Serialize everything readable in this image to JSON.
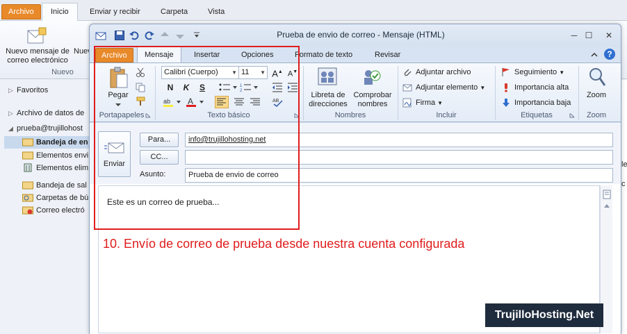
{
  "bg_window": {
    "tabs": [
      "Archivo",
      "Inicio",
      "Enviar y recibir",
      "Carpeta",
      "Vista"
    ],
    "new_mail_label": "Nuevo mensaje de correo electrónico",
    "new_item_label": "Nuevos elem",
    "group_label": "Nuevo",
    "nav": {
      "favorites": "Favoritos",
      "data_file": "Archivo de datos de",
      "account": "prueba@trujillohost",
      "folders": [
        {
          "label": "Bandeja de en",
          "icon": "inbox-icon"
        },
        {
          "label": "Elementos envi",
          "icon": "sent-items-icon"
        },
        {
          "label": "Elementos elim",
          "icon": "deleted-items-icon"
        },
        {
          "label": "Bandeja de sal",
          "icon": "outbox-icon"
        },
        {
          "label": "Carpetas de bú",
          "icon": "search-folder-icon"
        },
        {
          "label": "Correo electró",
          "icon": "junk-mail-icon"
        }
      ]
    },
    "right_fragments": [
      "le",
      "c"
    ]
  },
  "message_window": {
    "title": "Prueba de envio de correo  -  Mensaje (HTML)",
    "window_controls": {
      "minimize": "─",
      "maximize": "☐",
      "close": "✕"
    },
    "tabs": {
      "archivo": "Archivo",
      "mensaje": "Mensaje",
      "insertar": "Insertar",
      "opciones": "Opciones",
      "formato": "Formato de texto",
      "revisar": "Revisar"
    },
    "ribbon": {
      "paste": "Pegar",
      "group_clipboard": "Portapapeles",
      "font_name": "Calibri (Cuerpo)",
      "font_size": "11",
      "bold": "N",
      "italic": "K",
      "underline": "S",
      "group_basic_text": "Texto básico",
      "address_book": "Libreta de direcciones",
      "check_names": "Comprobar nombres",
      "group_names": "Nombres",
      "attach_file": "Adjuntar archivo",
      "attach_item": "Adjuntar elemento",
      "signature": "Firma",
      "group_include": "Incluir",
      "follow_up": "Seguimiento",
      "high_importance": "Importancia alta",
      "low_importance": "Importancia baja",
      "group_tags": "Etiquetas",
      "zoom": "Zoom",
      "group_zoom": "Zoom"
    },
    "compose": {
      "send": "Enviar",
      "to_button": "Para...",
      "cc_button": "CC...",
      "subject_label": "Asunto:",
      "to_value": "info@trujillohosting.net",
      "cc_value": "",
      "subject_value": "Prueba de envio de correo",
      "body": "Este es un correo de prueba..."
    }
  },
  "annotation": {
    "caption": "10. Envío de correo de prueba desde nuestra cuenta configurada",
    "watermark": "TrujilloHosting.Net",
    "highlight_color": "#e01c1c"
  },
  "colors": {
    "archivo_tab": "#e8892a",
    "ribbon_bg": "#e4ecf7",
    "selection": "#c8d9ee"
  }
}
